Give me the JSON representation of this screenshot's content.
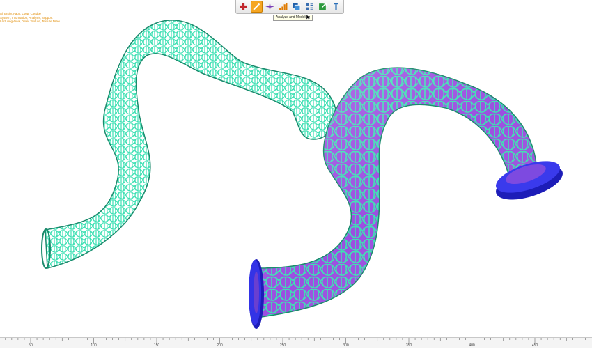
{
  "toolbar": {
    "buttons": [
      {
        "icon": "red-cross-icon",
        "active": false
      },
      {
        "icon": "wand-icon",
        "active": true
      },
      {
        "icon": "purple-star-icon",
        "active": false
      },
      {
        "icon": "bar-chart-icon",
        "active": false
      },
      {
        "icon": "copy-layers-icon",
        "active": false
      },
      {
        "icon": "grid-list-icon",
        "active": false
      },
      {
        "icon": "export-icon",
        "active": false
      },
      {
        "icon": "pin-icon",
        "active": false
      }
    ],
    "tooltip": "Analyze and Modeling"
  },
  "hint": {
    "line1": "All Entity, Face, Loop, Coedge",
    "line2_prefix": "System, ",
    "line2_link": "Information",
    "line2_suffix": ", Analysis, Support",
    "line3": "Lacturing Area, Drive, Texture, Texture Draw"
  },
  "ruler": {
    "labels": [
      "50",
      "100",
      "150",
      "200",
      "250",
      "300",
      "350",
      "400",
      "450"
    ]
  },
  "colors": {
    "lattice": "#3de0b3",
    "lattice_dark": "#1a8a6c",
    "solid_tube": "#9b4fe0",
    "flange": "#2a2ad8",
    "accent": "#f5a623"
  }
}
